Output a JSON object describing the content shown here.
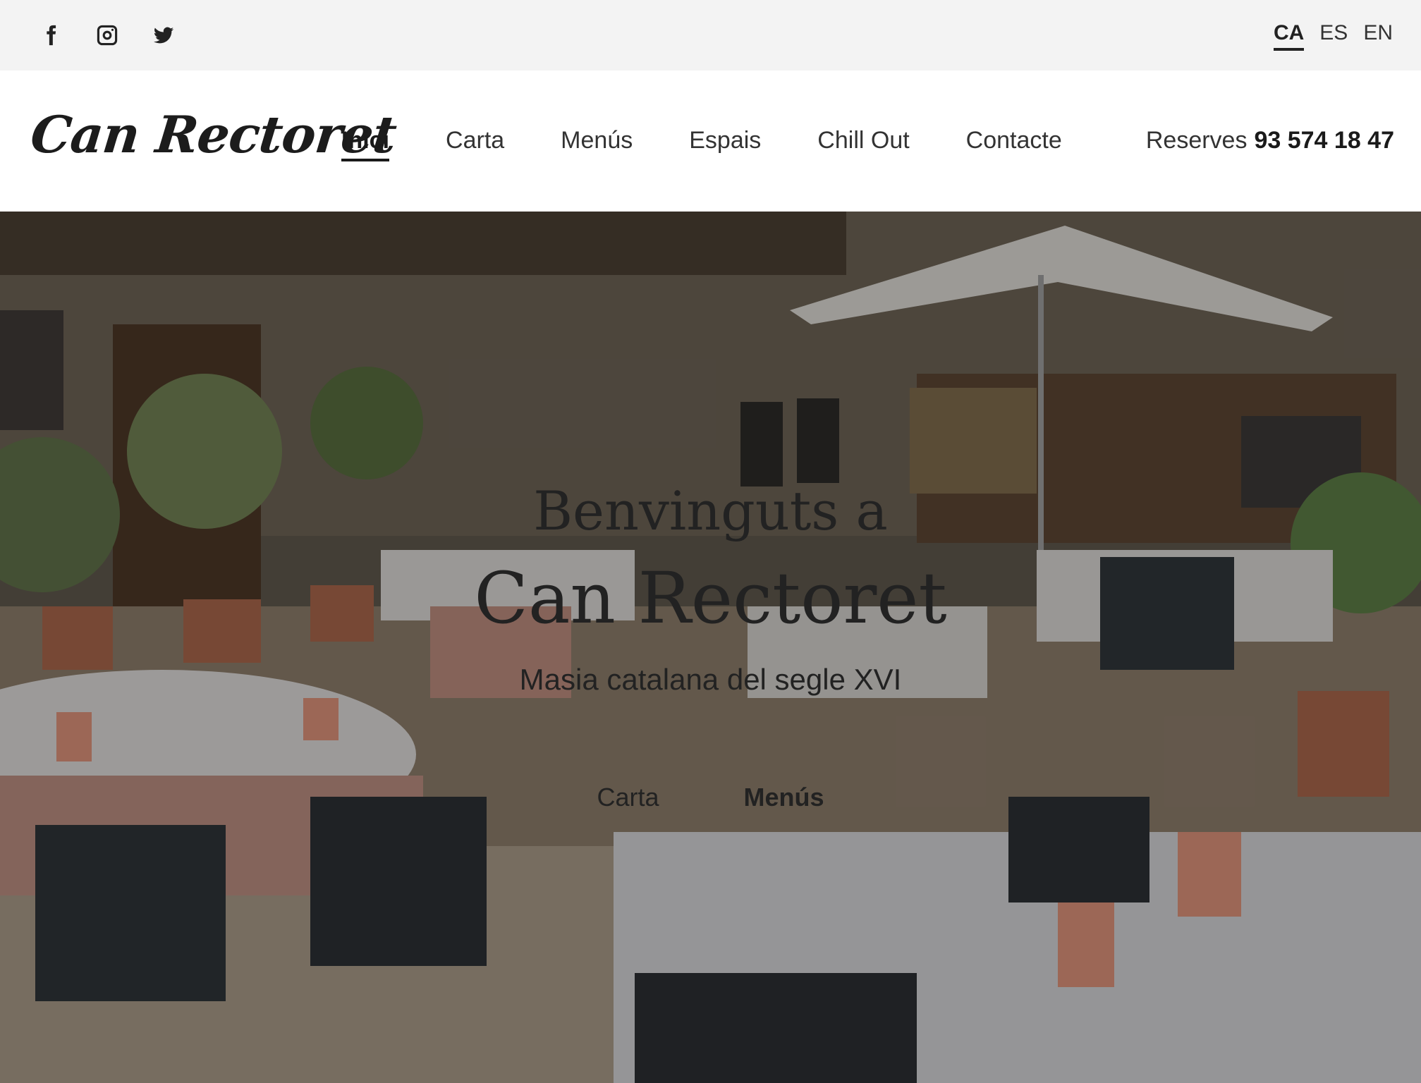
{
  "social": {
    "icons": [
      "facebook-icon",
      "instagram-icon",
      "twitter-icon"
    ]
  },
  "languages": {
    "items": [
      "CA",
      "ES",
      "EN"
    ],
    "active": "CA"
  },
  "header": {
    "logo": "Can Rectoret",
    "nav": [
      {
        "label": "Inici",
        "active": true
      },
      {
        "label": "Carta",
        "active": false
      },
      {
        "label": "Menús",
        "active": false
      },
      {
        "label": "Espais",
        "active": false
      },
      {
        "label": "Chill Out",
        "active": false
      },
      {
        "label": "Contacte",
        "active": false
      }
    ],
    "reserve_label": "Reserves",
    "reserve_phone": "93 574 18 47"
  },
  "hero": {
    "welcome": "Benvinguts a",
    "title": "Can Rectoret",
    "tagline": "Masia catalana del segle XVI",
    "links": [
      "Carta",
      "Menús"
    ]
  },
  "colors": {
    "topbar_bg": "#f3f3f3",
    "text_dark": "#1a1a1a",
    "hero_text": "#ffffff"
  }
}
